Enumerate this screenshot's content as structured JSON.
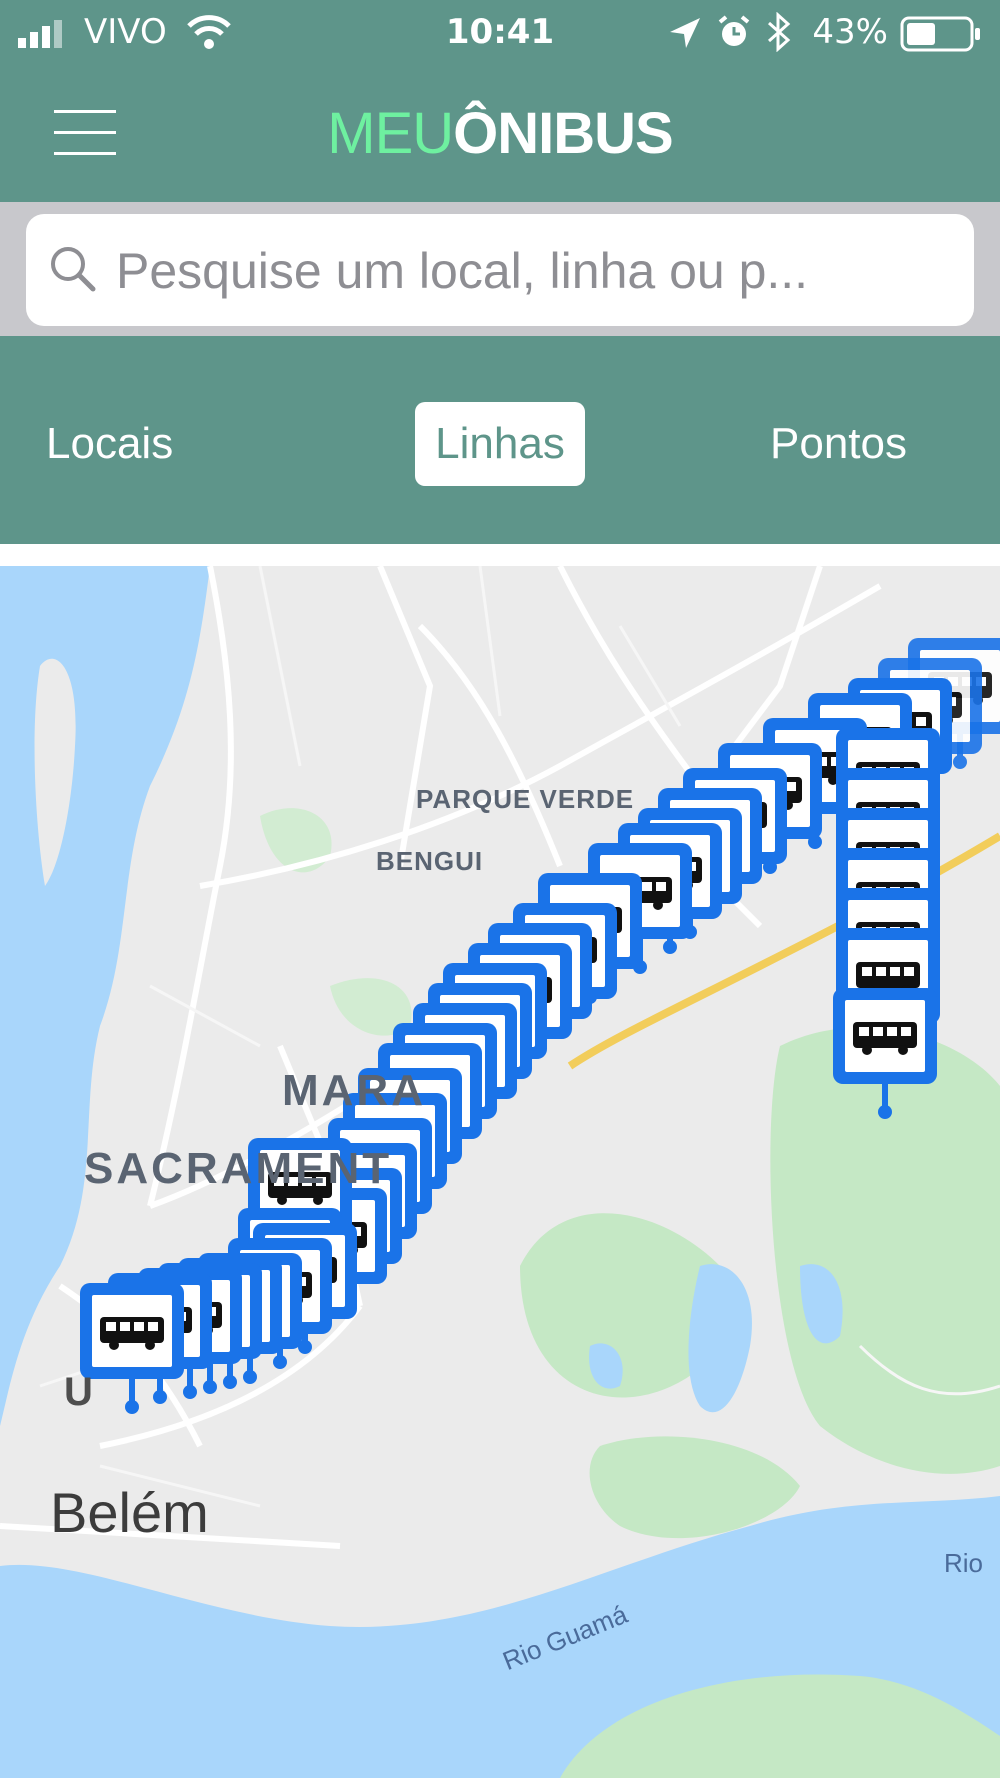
{
  "status_bar": {
    "carrier": "VIVO",
    "time": "10:41",
    "battery": "43%",
    "icons": [
      "signal-icon",
      "wifi-icon",
      "location-arrow-icon",
      "alarm-icon",
      "bluetooth-icon",
      "battery-icon"
    ]
  },
  "header": {
    "logo_part1": "MEU",
    "logo_part2": "ÔNIBUS",
    "menu_icon": "hamburger-menu-icon"
  },
  "search": {
    "placeholder": "Pesquise um local, linha ou p...",
    "value": ""
  },
  "tabs": [
    {
      "label": "Locais",
      "selected": false
    },
    {
      "label": "Linhas",
      "selected": true
    },
    {
      "label": "Pontos",
      "selected": false
    }
  ],
  "map": {
    "labels": {
      "parque_verde": "PARQUE VERDE",
      "bengui": "BENGUI",
      "marambaia": "MARA",
      "sacramenta": "SACRAMENT",
      "belem": "Belém",
      "rio_guama": "Rio Guamá",
      "rio": "Rio",
      "u": "U"
    },
    "marker_icon": "bus-stop-icon"
  },
  "colors": {
    "header_bg": "#5e958a",
    "logo_accent": "#6ef0a0",
    "marker_blue": "#1a73e8",
    "water": "#a9d6fb",
    "park": "#c5e8c5"
  }
}
